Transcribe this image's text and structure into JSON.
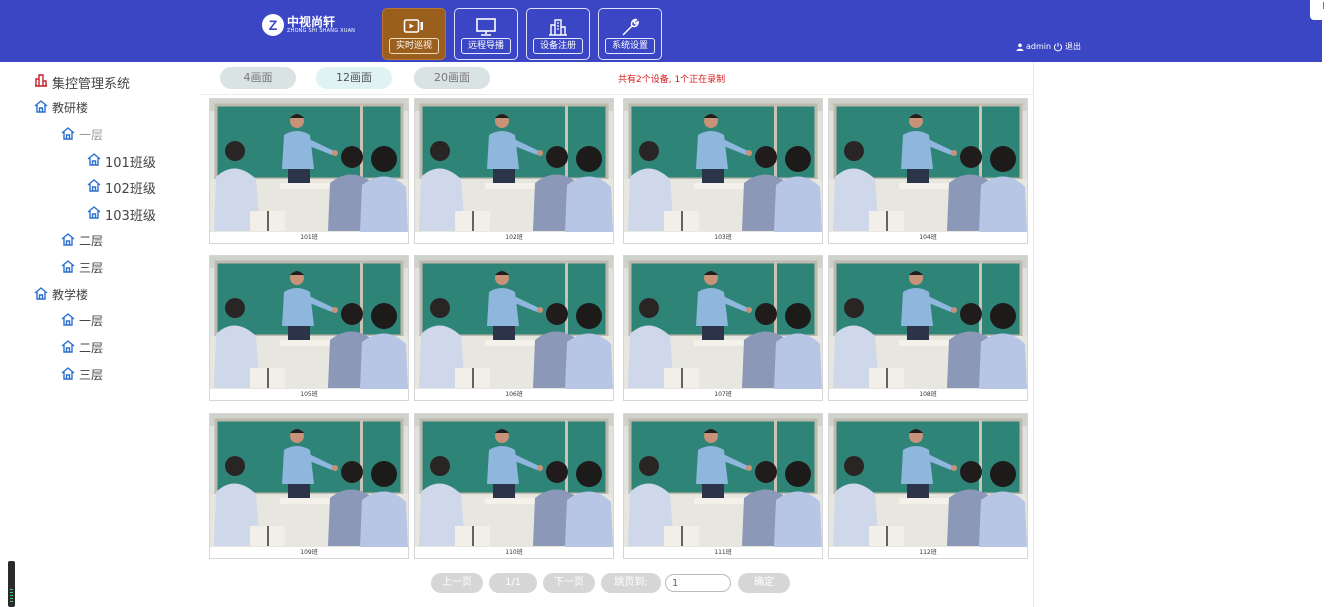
{
  "header": {
    "logo_name": "中视尚轩",
    "logo_sub": "ZHONG SHI SHANG XUAN",
    "nav": [
      {
        "label": "实时巡视",
        "icon": "video-icon",
        "active": true
      },
      {
        "label": "远程导播",
        "icon": "monitor-icon",
        "active": false
      },
      {
        "label": "设备注册",
        "icon": "building-icon",
        "active": false
      },
      {
        "label": "系统设置",
        "icon": "wrench-icon",
        "active": false
      }
    ],
    "user": "admin",
    "logout": "退出"
  },
  "sidebar": {
    "root": "集控管理系统",
    "tree": [
      {
        "label": "教研楼"
      },
      {
        "label": "一层"
      },
      {
        "label": "101班级"
      },
      {
        "label": "102班级"
      },
      {
        "label": "103班级"
      },
      {
        "label": "二层"
      },
      {
        "label": "三层"
      },
      {
        "label": "教学楼"
      },
      {
        "label": "一层"
      },
      {
        "label": "二层"
      },
      {
        "label": "三层"
      }
    ]
  },
  "toolbar": {
    "layouts": [
      "4画面",
      "12画面",
      "20画面"
    ],
    "active_layout": "12画面",
    "summary": "共有2个设备, 1个正在录制"
  },
  "cameras": [
    {
      "label": "101班"
    },
    {
      "label": "102班"
    },
    {
      "label": "103班"
    },
    {
      "label": "104班"
    },
    {
      "label": "105班"
    },
    {
      "label": "106班"
    },
    {
      "label": "107班"
    },
    {
      "label": "108班"
    },
    {
      "label": "109班"
    },
    {
      "label": "110班"
    },
    {
      "label": "111班"
    },
    {
      "label": "112班"
    }
  ],
  "pager": {
    "prev": "上一页",
    "page_info": "1/1",
    "next": "下一页",
    "jump_label": "跳页到:",
    "jump_value": "1",
    "confirm": "确定"
  },
  "colors": {
    "header": "#3a46c4",
    "active_nav": "#9a5e1d",
    "summary_text": "#d61b1b"
  }
}
